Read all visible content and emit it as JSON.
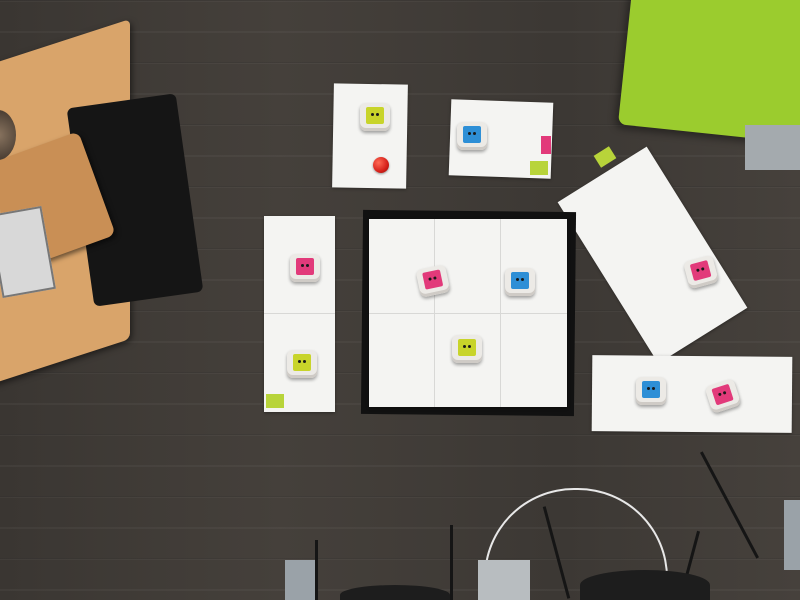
{
  "scene": {
    "description_free": true
  },
  "colors": {
    "floor": "#3f3b37",
    "paper": "#f4f4f2",
    "robot_body": "#eceae6",
    "face_yellow": "#c8d42a",
    "face_blue": "#2e8fd6",
    "face_pink": "#e23a7a",
    "ball_red": "#d6201a",
    "cube_green": "#9bcc2e",
    "table_wood": "#d9a46a",
    "mat_border": "#111111"
  },
  "icons": {
    "robot": "robot-icon",
    "ball": "ball-icon"
  }
}
